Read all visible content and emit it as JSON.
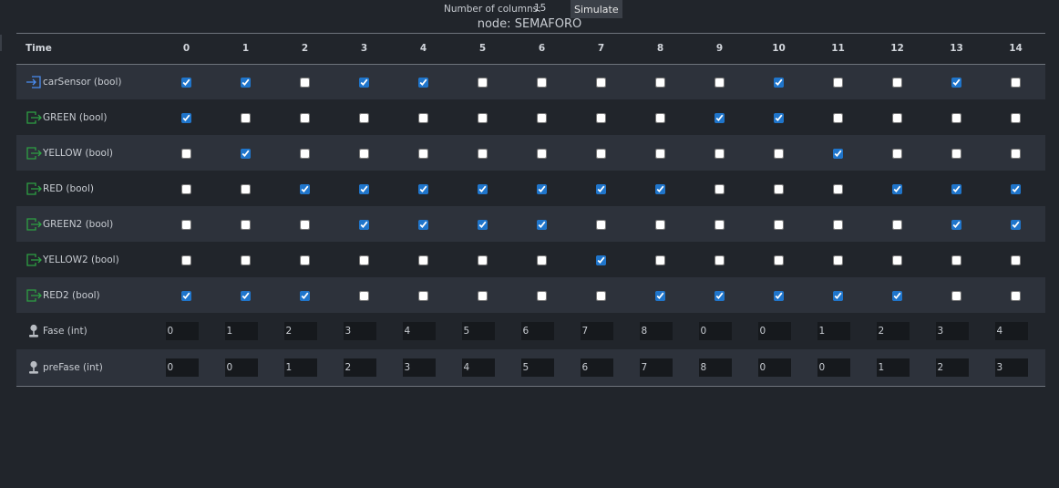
{
  "toolbar": {
    "columns_label": "Number of columns:",
    "columns_value": "15",
    "simulate_label": "Simulate"
  },
  "node_title": "node: SEMAFORO",
  "table": {
    "time_header": "Time",
    "columns": [
      "0",
      "1",
      "2",
      "3",
      "4",
      "5",
      "6",
      "7",
      "8",
      "9",
      "10",
      "11",
      "12",
      "13",
      "14"
    ],
    "rows": [
      {
        "label": "carSensor (bool)",
        "kind": "bool",
        "icon": "input-arrow-icon",
        "icon_color": "#4a8cf0",
        "values": [
          true,
          true,
          false,
          true,
          true,
          false,
          false,
          false,
          false,
          false,
          true,
          false,
          false,
          true,
          false
        ]
      },
      {
        "label": "GREEN (bool)",
        "kind": "bool",
        "icon": "output-arrow-icon",
        "icon_color": "#2ea043",
        "values": [
          true,
          false,
          false,
          false,
          false,
          false,
          false,
          false,
          false,
          true,
          true,
          false,
          false,
          false,
          false
        ]
      },
      {
        "label": "YELLOW (bool)",
        "kind": "bool",
        "icon": "output-arrow-icon",
        "icon_color": "#2ea043",
        "values": [
          false,
          true,
          false,
          false,
          false,
          false,
          false,
          false,
          false,
          false,
          false,
          true,
          false,
          false,
          false
        ]
      },
      {
        "label": "RED (bool)",
        "kind": "bool",
        "icon": "output-arrow-icon",
        "icon_color": "#2ea043",
        "values": [
          false,
          false,
          true,
          true,
          true,
          true,
          true,
          true,
          true,
          false,
          false,
          false,
          true,
          true,
          true
        ]
      },
      {
        "label": "GREEN2 (bool)",
        "kind": "bool",
        "icon": "output-arrow-icon",
        "icon_color": "#2ea043",
        "values": [
          false,
          false,
          false,
          true,
          true,
          true,
          true,
          false,
          false,
          false,
          false,
          false,
          false,
          true,
          true
        ]
      },
      {
        "label": "YELLOW2 (bool)",
        "kind": "bool",
        "icon": "output-arrow-icon",
        "icon_color": "#2ea043",
        "values": [
          false,
          false,
          false,
          false,
          false,
          false,
          false,
          true,
          false,
          false,
          false,
          false,
          false,
          false,
          false
        ]
      },
      {
        "label": "RED2 (bool)",
        "kind": "bool",
        "icon": "output-arrow-icon",
        "icon_color": "#2ea043",
        "values": [
          true,
          true,
          true,
          false,
          false,
          false,
          false,
          false,
          true,
          true,
          true,
          true,
          true,
          false,
          false
        ]
      },
      {
        "label": "Fase (int)",
        "kind": "int",
        "icon": "local-variable-icon",
        "icon_color": "#b8bcc2",
        "values": [
          "0",
          "1",
          "2",
          "3",
          "4",
          "5",
          "6",
          "7",
          "8",
          "0",
          "0",
          "1",
          "2",
          "3",
          "4"
        ]
      },
      {
        "label": "preFase (int)",
        "kind": "int",
        "icon": "local-variable-icon",
        "icon_color": "#b8bcc2",
        "values": [
          "0",
          "0",
          "1",
          "2",
          "3",
          "4",
          "5",
          "6",
          "7",
          "8",
          "0",
          "0",
          "1",
          "2",
          "3"
        ]
      }
    ]
  }
}
